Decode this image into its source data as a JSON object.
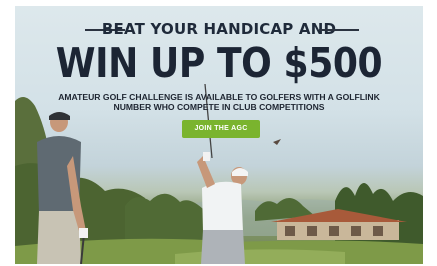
{
  "banner": {
    "headline_top": "BEAT YOUR HANDICAP AND",
    "headline_main": "WIN UP TO $500",
    "subline_1": "AMATEUR GOLF CHALLENGE IS AVAILABLE TO GOLFERS WITH A GOLFLINK",
    "subline_2": "NUMBER WHO COMPETE IN CLUB COMPETITIONS",
    "cta_label": "JOIN THE AGC",
    "colors": {
      "headline": "#1c2534",
      "cta_background": "#7ab42e",
      "cta_text": "#ffffff"
    }
  }
}
